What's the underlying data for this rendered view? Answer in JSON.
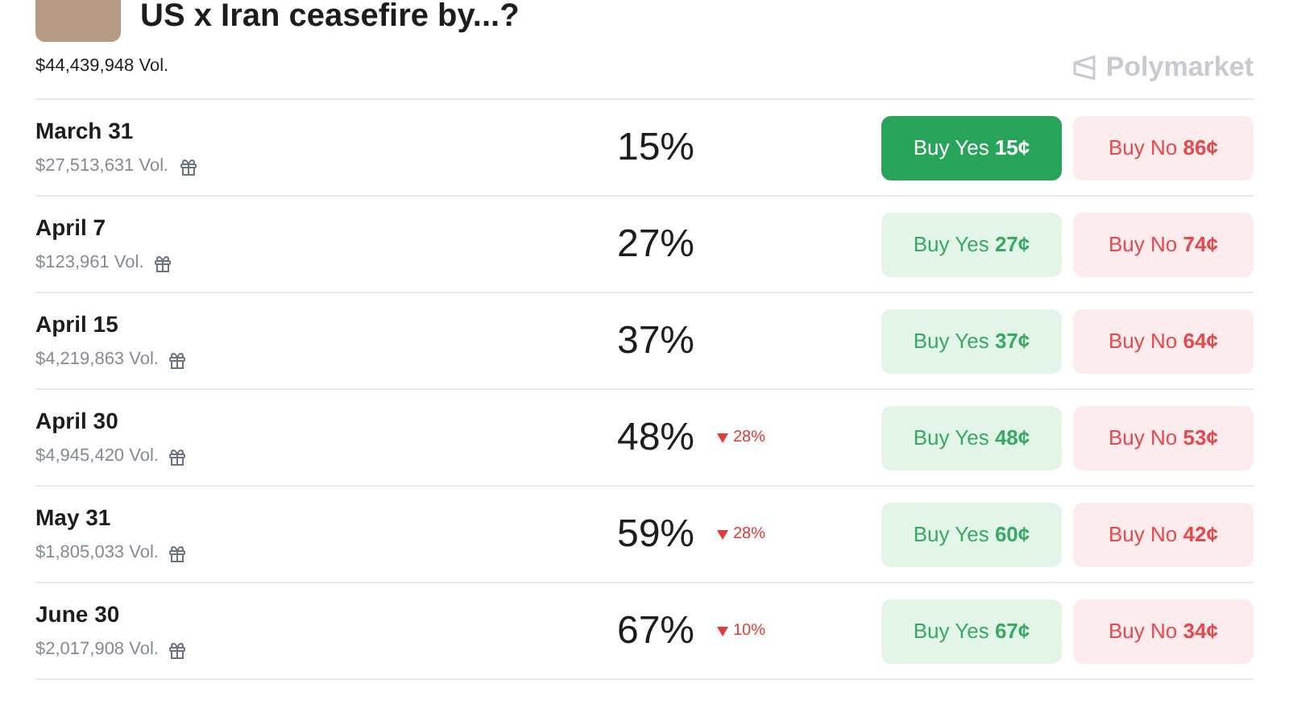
{
  "title": "US x Iran ceasefire by...?",
  "volume": "$44,439,948 Vol.",
  "brand": "Polymarket",
  "rows": [
    {
      "date": "March 31",
      "volume": "$27,513,631 Vol.",
      "chance": "15%",
      "yes": {
        "label": "Buy Yes **15¢**",
        "highlighted": true
      },
      "no": "Buy No **86¢**"
    },
    {
      "date": "April 7",
      "volume": "$123,961 Vol.",
      "chance": "27%",
      "yes": {
        "label": "Buy Yes **27¢**",
        "highlighted": false
      },
      "no": "Buy No **74¢**"
    },
    {
      "date": "April 15",
      "volume": "$4,219,863 Vol.",
      "chance": "37%",
      "yes": {
        "label": "Buy Yes **37¢**",
        "highlighted": false
      },
      "no": "Buy No **64¢**"
    },
    {
      "date": "April 30",
      "volume": "$4,945,420 Vol.",
      "chance": "48%",
      "change": {
        "kind": "down",
        "text": "28%"
      },
      "yes": {
        "label": "Buy Yes **48¢**",
        "highlighted": false
      },
      "no": "Buy No **53¢**"
    },
    {
      "date": "May 31",
      "volume": "$1,805,033 Vol.",
      "chance": "59%",
      "change": {
        "kind": "down",
        "text": "28%"
      },
      "yes": {
        "label": "Buy Yes **60¢**",
        "highlighted": false
      },
      "no": "Buy No **42¢**"
    },
    {
      "date": "June 30",
      "volume": "$2,017,908 Vol.",
      "chance": "67%",
      "change": {
        "kind": "down",
        "text": "10%"
      },
      "yes": {
        "label": "Buy Yes **67¢**",
        "highlighted": false
      },
      "no": "Buy No **34¢**"
    }
  ]
}
